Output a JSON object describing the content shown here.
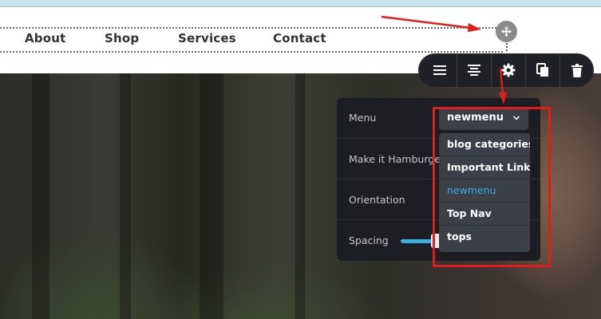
{
  "nav": {
    "items": [
      {
        "label": "About"
      },
      {
        "label": "Shop"
      },
      {
        "label": "Services"
      },
      {
        "label": "Contact"
      }
    ]
  },
  "toolbar": {
    "icons": [
      "hamburger-icon",
      "align-center-icon",
      "gear-icon",
      "copy-icon",
      "trash-icon"
    ]
  },
  "settings": {
    "menu_label": "Menu",
    "menu_value": "newmenu",
    "hamburger_label": "Make it Hamburger",
    "orientation_label": "Orientation",
    "spacing_label": "Spacing"
  },
  "dropdown": {
    "options": [
      {
        "label": "blog categories"
      },
      {
        "label": "Important Links"
      },
      {
        "label": "newmenu"
      },
      {
        "label": "Top Nav"
      },
      {
        "label": "tops"
      }
    ],
    "selected": "newmenu"
  },
  "colors": {
    "accent": "#35b0df",
    "annotation": "#e31b1b",
    "panel": "#1c1e23"
  }
}
